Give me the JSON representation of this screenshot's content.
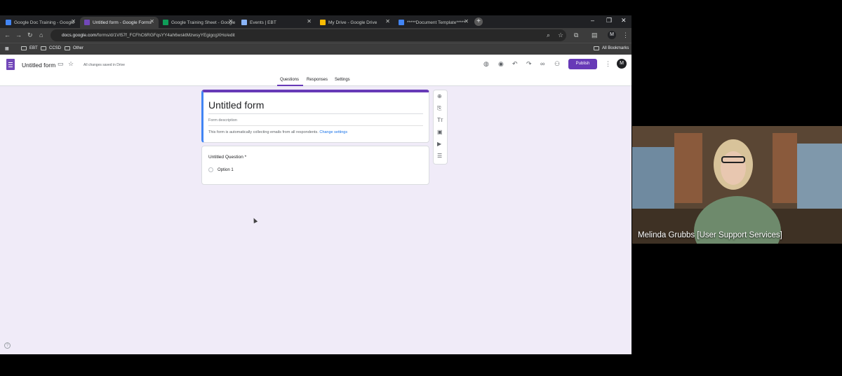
{
  "browser": {
    "tabs": [
      {
        "label": "Google Doc Training - Google",
        "active": false,
        "color": "#4285f4"
      },
      {
        "label": "Untitled form - Google Forms",
        "active": true,
        "color": "#7248b9"
      },
      {
        "label": "Google Training Sheet - Google",
        "active": false,
        "color": "#0f9d58"
      },
      {
        "label": "Events | EBT",
        "active": false,
        "color": "#5f6368"
      },
      {
        "label": "My Drive - Google Drive",
        "active": false,
        "color": "#fbbc04"
      },
      {
        "label": "*****Document Template*****",
        "active": false,
        "color": "#4285f4"
      }
    ],
    "url_domain": "docs.google.com",
    "url_path": "/forms/d/1Vl57f_FCFhC6RGFqsYY4ah6wsktMzwsyYEgigcgXHo/edit",
    "bookmarks": [
      "EBT",
      "CCSD",
      "Other"
    ],
    "all_bookmarks": "All Bookmarks",
    "profile_initial": "M"
  },
  "forms_header": {
    "doc_title": "Untitled form",
    "save_status": "All changes saved in Drive",
    "publish_label": "Publish",
    "avatar_initial": "M",
    "tabs": [
      "Questions",
      "Responses",
      "Settings"
    ],
    "accent_color": "#673ab7"
  },
  "form": {
    "title": "Untitled form",
    "description_placeholder": "Form description",
    "email_note": "This form is automatically collecting emails from all respondents.",
    "change_settings": "Change settings",
    "question": {
      "title": "Untitled Question *",
      "options": [
        "Option 1"
      ]
    }
  },
  "side_tools": [
    "add-question-icon",
    "import-questions-icon",
    "add-title-icon",
    "add-image-icon",
    "add-video-icon",
    "add-section-icon"
  ],
  "video": {
    "participant_name": "Melinda Grubbs [User Support Services]"
  }
}
